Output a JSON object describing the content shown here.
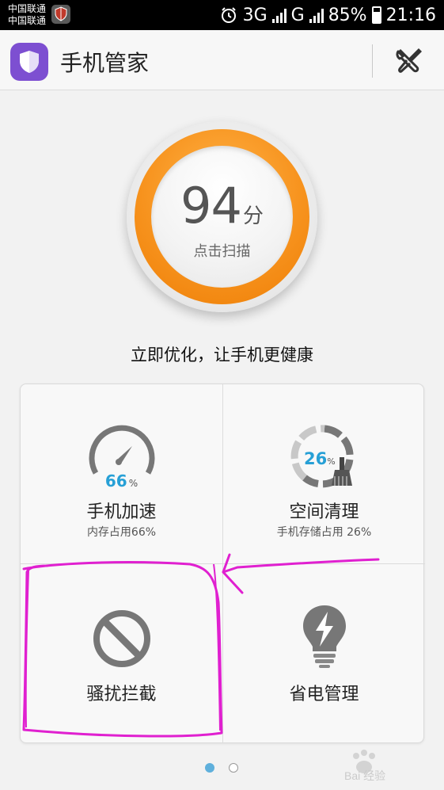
{
  "status_bar": {
    "carrier_1": "中国联通",
    "carrier_2": "中国联通",
    "network_1": "3G",
    "network_2": "G",
    "battery": "85%",
    "time": "21:16"
  },
  "header": {
    "title": "手机管家",
    "logo_icon": "shield-icon",
    "settings_icon": "tools-icon"
  },
  "score": {
    "value": "94",
    "unit": "分",
    "action": "点击扫描"
  },
  "tagline": "立即优化，让手机更健康",
  "tiles": [
    {
      "title": "手机加速",
      "subtitle": "内存占用66%",
      "percent": "66",
      "percent_sign": "%",
      "icon": "speedometer-icon"
    },
    {
      "title": "空间清理",
      "subtitle": "手机存储占用 26%",
      "percent": "26",
      "percent_sign": "%",
      "icon": "broom-icon"
    },
    {
      "title": "骚扰拦截",
      "icon": "block-icon"
    },
    {
      "title": "省电管理",
      "icon": "lightning-bulb-icon"
    }
  ],
  "pager": {
    "pages": 2,
    "active": 1
  },
  "watermark": {
    "text": "Bai 经验"
  },
  "colors": {
    "accent_orange": "#f7931e",
    "accent_blue": "#27a0d6",
    "annotation": "#e020d0",
    "logo_purple": "#7d4fd1"
  }
}
